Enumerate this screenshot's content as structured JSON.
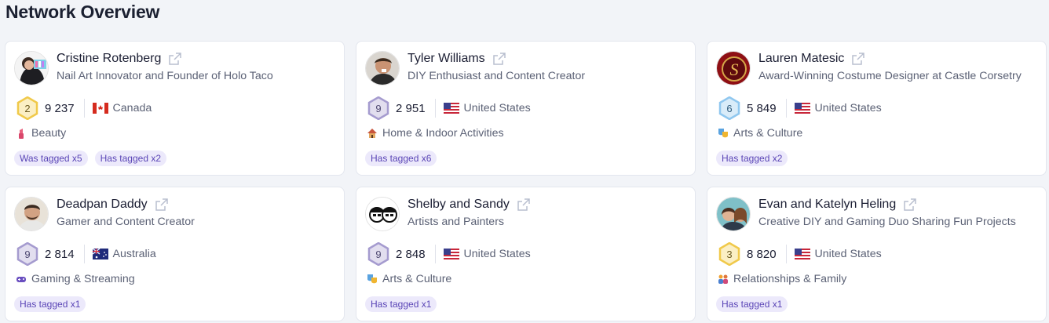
{
  "page": {
    "title": "Network Overview"
  },
  "cards": [
    {
      "name": "Cristine Rotenberg",
      "subtitle": "Nail Art Innovator and Founder of Holo Taco",
      "level": "2",
      "level_color": "#f0c94a",
      "followers": "9 237",
      "country": "Canada",
      "flag": "canada-flag-icon",
      "category": "Beauty",
      "category_icon": "lipstick-icon",
      "tags": [
        "Was tagged x5",
        "Has tagged x2"
      ]
    },
    {
      "name": "Tyler Williams",
      "subtitle": "DIY Enthusiast and Content Creator",
      "level": "9",
      "level_color": "#a59bcf",
      "followers": "2 951",
      "country": "United States",
      "flag": "us-flag-icon",
      "category": "Home & Indoor Activities",
      "category_icon": "house-icon",
      "tags": [
        "Has tagged x6"
      ]
    },
    {
      "name": "Lauren Matesic",
      "subtitle": "Award-Winning Costume Designer at Castle Corsetry",
      "level": "6",
      "level_color": "#8fc7ef",
      "followers": "5 849",
      "country": "United States",
      "flag": "us-flag-icon",
      "category": "Arts & Culture",
      "category_icon": "theater-masks-icon",
      "tags": [
        "Has tagged x2"
      ]
    },
    {
      "name": "Deadpan Daddy",
      "subtitle": "Gamer and Content Creator",
      "level": "9",
      "level_color": "#a59bcf",
      "followers": "2 814",
      "country": "Australia",
      "flag": "australia-flag-icon",
      "category": "Gaming & Streaming",
      "category_icon": "gamepad-icon",
      "tags": [
        "Has tagged x1"
      ]
    },
    {
      "name": "Shelby and Sandy",
      "subtitle": "Artists and Painters",
      "level": "9",
      "level_color": "#a59bcf",
      "followers": "2 848",
      "country": "United States",
      "flag": "us-flag-icon",
      "category": "Arts & Culture",
      "category_icon": "theater-masks-icon",
      "tags": [
        "Has tagged x1"
      ]
    },
    {
      "name": "Evan and Katelyn Heling",
      "subtitle": "Creative DIY and Gaming Duo Sharing Fun Projects",
      "level": "3",
      "level_color": "#f0c94a",
      "followers": "8 820",
      "country": "United States",
      "flag": "us-flag-icon",
      "category": "Relationships & Family",
      "category_icon": "family-icon",
      "tags": [
        "Has tagged x1"
      ]
    }
  ]
}
